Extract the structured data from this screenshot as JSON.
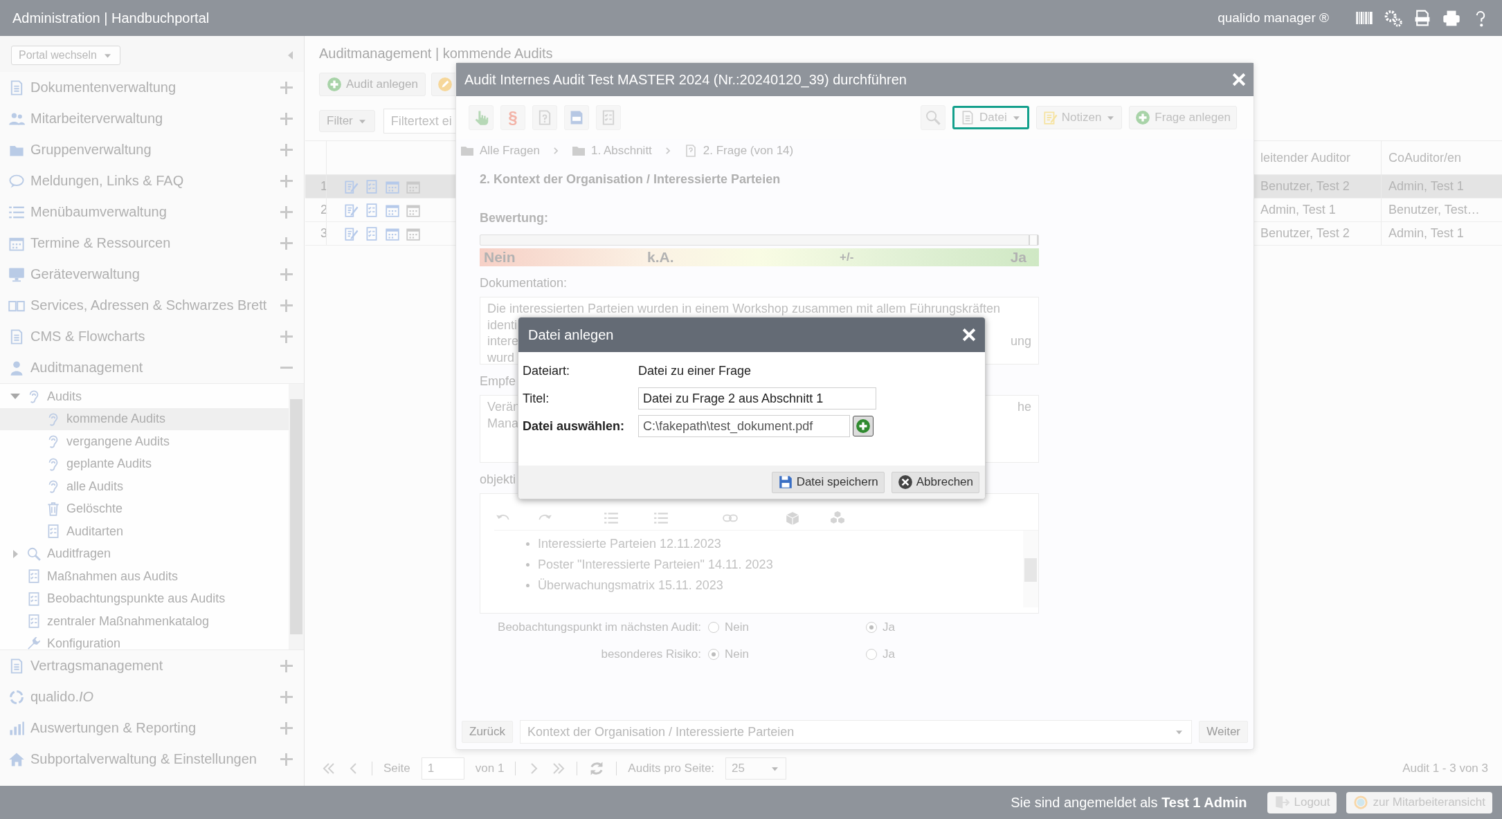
{
  "header": {
    "title": "Administration | Handbuchportal",
    "product": "qualido manager ®"
  },
  "sidebar": {
    "portal_select": "Portal wechseln",
    "items": [
      {
        "label": "Dokumentenverwaltung",
        "expanded": false
      },
      {
        "label": "Mitarbeiterverwaltung",
        "expanded": false
      },
      {
        "label": "Gruppenverwaltung",
        "expanded": false
      },
      {
        "label": "Meldungen, Links & FAQ",
        "expanded": false
      },
      {
        "label": "Menübaumverwaltung",
        "expanded": false
      },
      {
        "label": "Termine & Ressourcen",
        "expanded": false
      },
      {
        "label": "Geräteverwaltung",
        "expanded": false
      },
      {
        "label": "Services, Adressen & Schwarzes Brett",
        "expanded": false
      },
      {
        "label": "CMS & Flowcharts",
        "expanded": false
      },
      {
        "label": "Auditmanagement",
        "expanded": true,
        "children": [
          {
            "label": "Audits",
            "expanded": true,
            "selected": false,
            "children": [
              {
                "label": "kommende Audits",
                "selected": true
              },
              {
                "label": "vergangene Audits",
                "selected": false
              },
              {
                "label": "geplante Audits",
                "selected": false
              },
              {
                "label": "alle Audits",
                "selected": false
              },
              {
                "label": "Gelöschte",
                "selected": false
              },
              {
                "label": "Auditarten",
                "selected": false
              }
            ]
          },
          {
            "label": "Auditfragen",
            "expanded": false,
            "selected": false
          },
          {
            "label": "Maßnahmen aus Audits",
            "selected": false
          },
          {
            "label": "Beobachtungspunkte aus Audits",
            "selected": false
          },
          {
            "label": "zentraler Maßnahmenkatalog",
            "selected": false
          },
          {
            "label": "Konfiguration",
            "selected": false
          }
        ]
      },
      {
        "label": "Vertragsmanagement",
        "expanded": false
      },
      {
        "label": "qualido.*IO*",
        "expanded": false
      },
      {
        "label": "Auswertungen & Reporting",
        "expanded": false
      },
      {
        "label": "Subportalverwaltung & Einstellungen",
        "expanded": false
      }
    ]
  },
  "page": {
    "breadcrumb": "Auditmanagement | kommende Audits",
    "create_button": "Audit anlegen",
    "filter_button": "Filter",
    "filter_placeholder": "Filtertext ei"
  },
  "table": {
    "columns": [
      "leitender Auditor",
      "CoAuditor/en"
    ],
    "rows": [
      {
        "number": "1",
        "selected": true,
        "lead_auditor": "Benutzer, Test 2",
        "co_auditors": "Admin, Test 1"
      },
      {
        "number": "2",
        "selected": false,
        "lead_auditor": "Admin, Test 1",
        "co_auditors": "Benutzer, Test…"
      },
      {
        "number": "3",
        "selected": false,
        "lead_auditor": "Benutzer, Test 2",
        "co_auditors": "Admin, Test 1"
      }
    ]
  },
  "pagination": {
    "page_label": "Seite",
    "page": "1",
    "of": "von 1",
    "per_page_label": "Audits pro Seite:",
    "per_page": "25",
    "summary": "Audit 1 - 3 von 3"
  },
  "footer": {
    "login_text": "Sie sind angemeldet als **Test 1 Admin**",
    "logout": "Logout",
    "employee_view": "zur Mitarbeiteransicht"
  },
  "audit_modal": {
    "title": "Audit Internes Audit Test MASTER 2024 (Nr.:20240120_39) durchführen",
    "toolbar": [
      {
        "kind": "hand"
      },
      {
        "kind": "glyph",
        "text": "§"
      },
      {
        "kind": "question"
      },
      {
        "kind": "iso"
      },
      {
        "kind": "checklist"
      }
    ],
    "datei_button": {
      "label": "Datei",
      "focused": true
    },
    "notes_button": "Notizen",
    "add_question_button": "Frage anlegen",
    "breadcrumb": [
      "Alle Fragen",
      "1. Abschnitt",
      "2. Frage (von 14)"
    ],
    "question": "2. Kontext der Organisation / Interessierte Parteien",
    "rating_label": "Bewertung:",
    "rating": {
      "level": 1.0
    },
    "scale": [
      "Nein",
      "k.A.",
      "+/-",
      "Ja"
    ],
    "documentation_label": "Dokumentation:",
    "documentation_lines": [
      {
        "left": "Die interessierten Parteien wurden in einem Workshop zusammen mit allem Führungskräften"
      },
      {
        "left": "identi"
      },
      {
        "left": "intere",
        "right": "ung"
      },
      {
        "left": "wurd"
      }
    ],
    "recommendation_label": "Empfe",
    "recommendation_lines": [
      {
        "left": "Verän",
        "right": "he"
      },
      {
        "left": "Mana"
      }
    ],
    "objective_label": "objekti",
    "objective_items": [
      "Interessierte Parteien 12.11.2023",
      "Poster \"Interessierte Parteien\" 14.11. 2023",
      "Überwachungsmatrix  15.11. 2023"
    ],
    "radios": [
      {
        "label": "Beobachtungspunkt im nächsten Audit:",
        "options": [
          {
            "label": "Nein",
            "selected": false
          },
          {
            "label": "Ja",
            "selected": true
          }
        ]
      },
      {
        "label": "besonderes Risiko:",
        "options": [
          {
            "label": "Nein",
            "selected": true
          },
          {
            "label": "Ja",
            "selected": false
          }
        ]
      }
    ],
    "back_button": "Zurück",
    "section_select": "Kontext der Organisation / Interessierte Parteien",
    "next_button": "Weiter"
  },
  "file_dialog": {
    "title": "Datei anlegen",
    "type_label": "Dateiart:",
    "type_value": "Datei zu einer Frage",
    "title_label": "Titel:",
    "title_value": "Datei zu Frage 2 aus Abschnitt 1",
    "file_label": "Datei auswählen:",
    "file_value": "C:\\fakepath\\test_dokument.pdf",
    "save_button": "Datei speichern",
    "cancel_button": "Abbrechen"
  }
}
